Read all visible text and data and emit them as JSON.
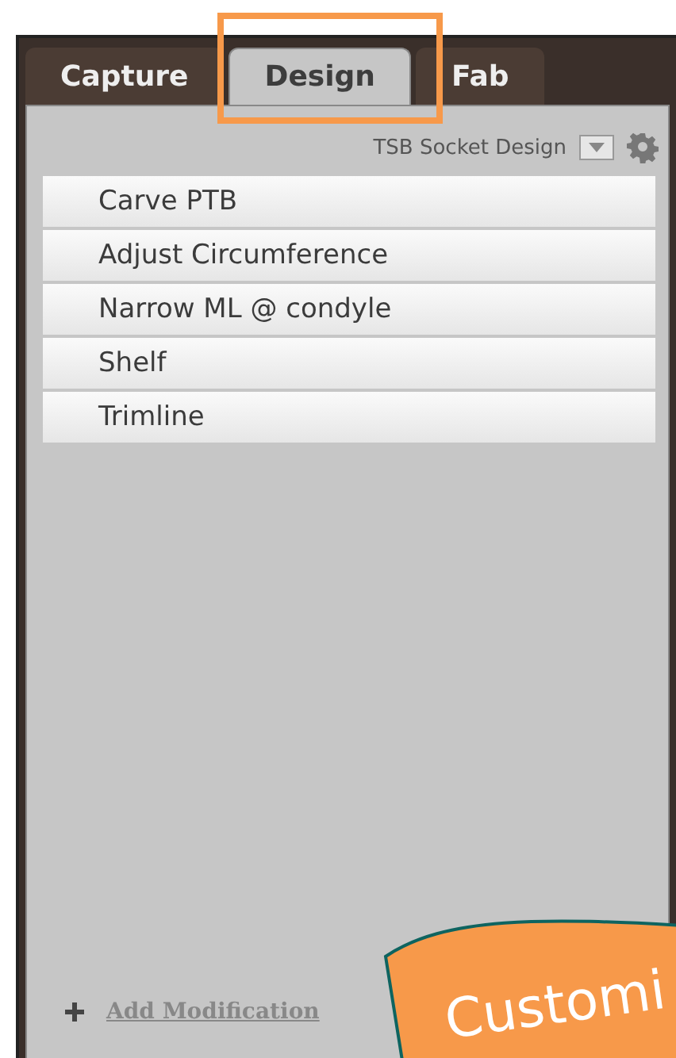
{
  "tabs": [
    {
      "label": "Capture",
      "selected": false
    },
    {
      "label": "Design",
      "selected": true
    },
    {
      "label": "Fab",
      "selected": false
    }
  ],
  "design_name": "TSB Socket Design",
  "modifications": [
    {
      "label": "Carve PTB"
    },
    {
      "label": "Adjust Circumference"
    },
    {
      "label": "Narrow ML @ condyle"
    },
    {
      "label": "Shelf"
    },
    {
      "label": "Trimline"
    }
  ],
  "add_link": "Add Modification",
  "callout": {
    "text": "Customi"
  }
}
